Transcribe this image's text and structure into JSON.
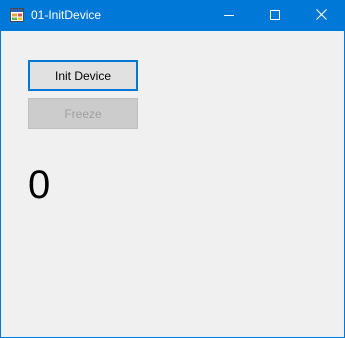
{
  "window": {
    "title": "01-InitDevice",
    "icon": "app-form-icon",
    "controls": {
      "minimize_icon": "minimize-icon",
      "maximize_icon": "maximize-icon",
      "close_icon": "close-icon"
    },
    "colors": {
      "titlebar": "#0078d7",
      "background": "#f0f0f0",
      "focus_border": "#0078d7"
    }
  },
  "buttons": {
    "init_label": "Init Device",
    "freeze_label": "Freeze",
    "freeze_enabled": false
  },
  "counter": {
    "value": "0"
  }
}
